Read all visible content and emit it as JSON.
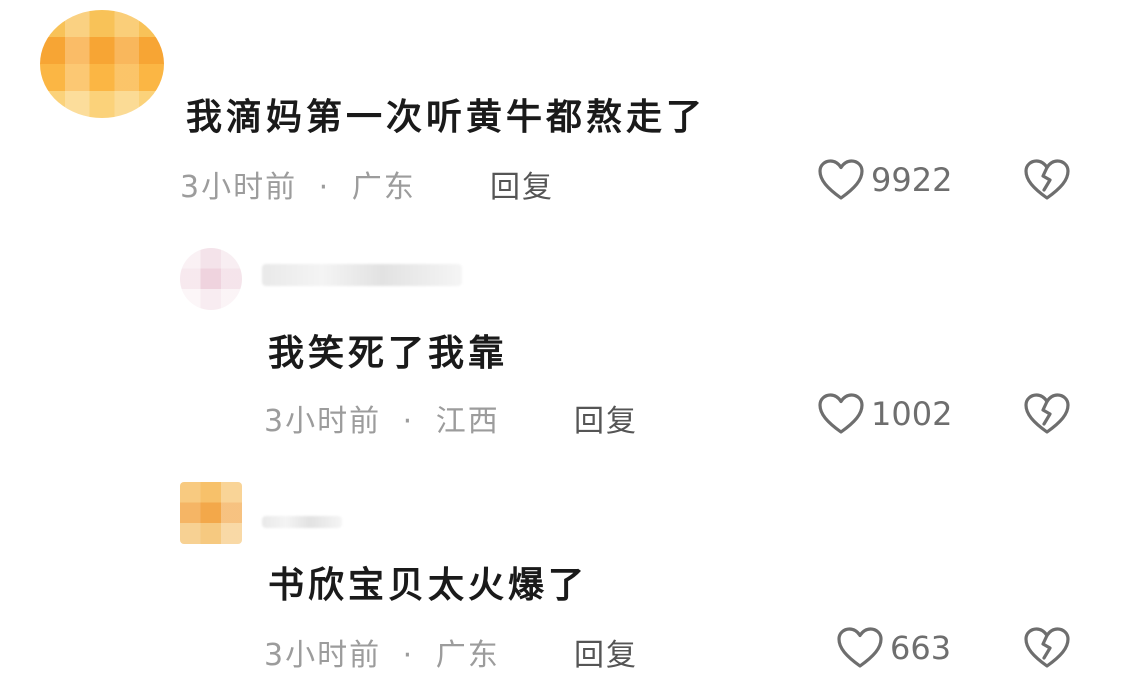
{
  "comments": [
    {
      "text": "我滴妈第一次听黄牛都熬走了",
      "time": "3小时前",
      "location": "广东",
      "reply_label": "回复",
      "likes": "9922"
    },
    {
      "text": "我笑死了我靠",
      "time": "3小时前",
      "location": "江西",
      "reply_label": "回复",
      "likes": "1002"
    },
    {
      "text": "书欣宝贝太火爆了",
      "time": "3小时前",
      "location": "广东",
      "reply_label": "回复",
      "likes": "663"
    }
  ],
  "meta_separator": "·",
  "icons": {
    "like": "heart-outline-icon",
    "dislike": "broken-heart-icon"
  },
  "colors": {
    "text": "#1a1a1a",
    "meta": "#9c9c9c",
    "icon": "#6e6e6e"
  }
}
